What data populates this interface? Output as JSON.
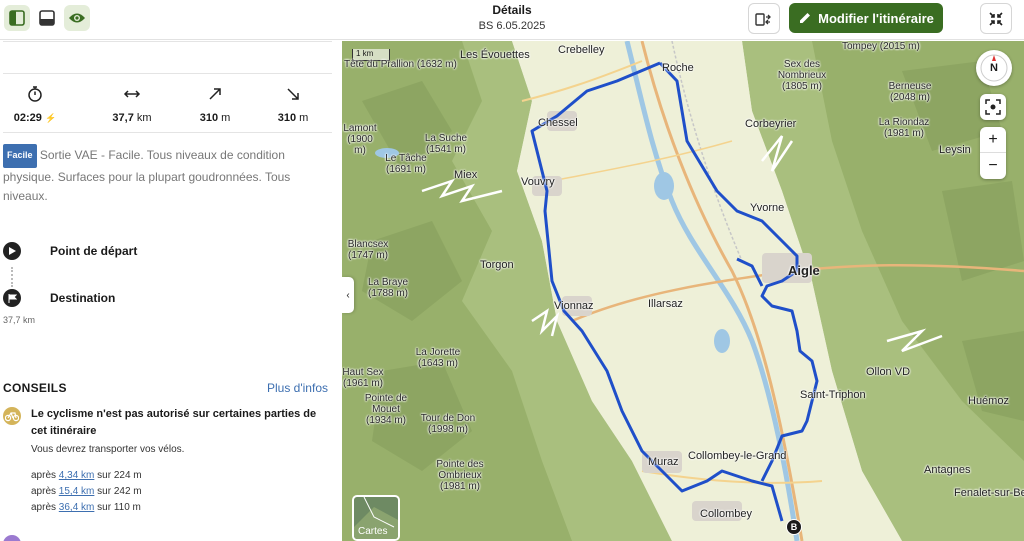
{
  "header": {
    "title": "Détails",
    "subtitle": "BS 6.05.2025",
    "modify_label": "Modifier l'itinéraire"
  },
  "stats": [
    {
      "icon": "stopwatch-icon",
      "value": "02:29",
      "unit": ""
    },
    {
      "icon": "distance-arrows-icon",
      "value": "37,7",
      "unit": "km"
    },
    {
      "icon": "ascent-arrow-icon",
      "value": "310",
      "unit": "m"
    },
    {
      "icon": "descent-arrow-icon",
      "value": "310",
      "unit": "m"
    }
  ],
  "difficulty": {
    "badge": "Facile",
    "description": "Sortie VAE - Facile. Tous niveaux de condition physique. Surfaces pour la plupart goudronnées. Tous niveaux."
  },
  "waypoints": {
    "start_label": "Point de départ",
    "end_label": "Destination",
    "distance": "37,7 km"
  },
  "tips": {
    "title": "CONSEILS",
    "more_link": "Plus d'infos",
    "warning_title": "Le cyclisme n'est pas autorisé sur certaines parties de cet itinéraire",
    "warning_sub": "Vous devrez transporter vos vélos.",
    "segments": [
      {
        "prefix": "après",
        "link": "4,34 km",
        "suffix": "sur 224 m"
      },
      {
        "prefix": "après",
        "link": "15,4 km",
        "suffix": "sur 242 m"
      },
      {
        "prefix": "après",
        "link": "36,4 km",
        "suffix": "sur 110 m"
      }
    ]
  },
  "map": {
    "scale_label": "1 km",
    "layers_label": "Cartes",
    "compass_label": "N",
    "end_marker": "B",
    "colors": {
      "route": "#1f4fc9",
      "water": "#9fc7e4",
      "forest": "#a9bf7e",
      "valley": "#eef0d8"
    },
    "labels": {
      "tete_prallion": "Tête du Prallion (1632 m)",
      "les_evouettes": "Les Évouettes",
      "crebelley": "Crebelley",
      "tompey": "Tompey (2015 m)",
      "roche": "Roche",
      "sex_nombrieux": "Sex des Nombrieux (1805 m)",
      "berneuse": "Berneuse (2048 m)",
      "chessel": "Chessel",
      "lamont": "Lamont (1900 m)",
      "la_suche": "La Suche (1541 m)",
      "corbeyrier": "Corbeyrier",
      "la_riondaz": "La Riondaz (1981 m)",
      "leysin": "Leysin",
      "le_tache": "Le Tâche (1691 m)",
      "miex": "Miex",
      "vouvry": "Vouvry",
      "yvorne": "Yvorne",
      "blancsex": "Blancsex (1747 m)",
      "torgon": "Torgon",
      "aigle": "Aigle",
      "la_braye": "La Braye (1788 m)",
      "vionnaz": "Vionnaz",
      "illarsaz": "Illarsaz",
      "la_jorette": "La Jorette (1643 m)",
      "haut_sex": "Haut Sex (1961 m)",
      "ollon": "Ollon VD",
      "saint_triphon": "Saint-Triphon",
      "pointe_mouet": "Pointe de Mouet (1934 m)",
      "tour_don": "Tour de Don (1998 m)",
      "huemoz": "Huémoz",
      "muraz": "Muraz",
      "collombey_grand": "Collombey-le-Grand",
      "pointe_ombrieux": "Pointe des Ombrieux (1981 m)",
      "antagnes": "Antagnes",
      "collombey": "Collombey",
      "fenalet": "Fenalet-sur-Bex"
    }
  }
}
